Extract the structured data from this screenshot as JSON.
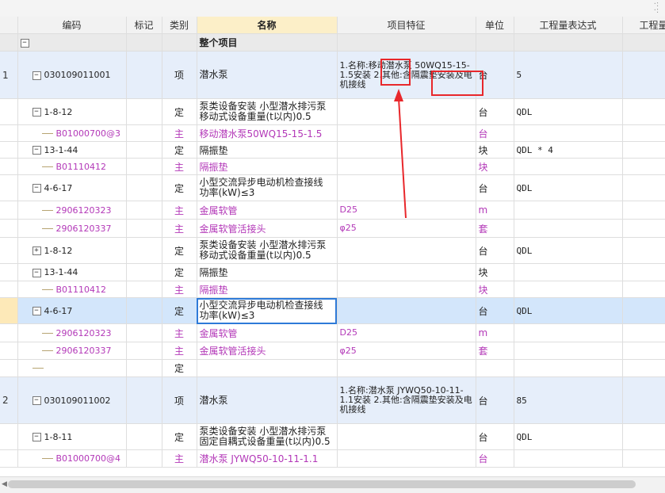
{
  "header": {
    "idx": "",
    "code": "编码",
    "mark": "标记",
    "type": "类别",
    "name": "名称",
    "feature": "项目特征",
    "unit": "单位",
    "qty_expr": "工程量表达式",
    "qty": "工程量"
  },
  "group": {
    "toggle": "−",
    "name": "整个项目"
  },
  "rows": [
    {
      "idx": "1",
      "code": "030109011001",
      "type": "项",
      "name": "潜水泵",
      "feature": "1.名称:移动潜水泵 50WQ15-15-1.5安装 2.其他:含隔震垫安装及电机接线",
      "unit": "台",
      "qty_expr": "5",
      "toggle": "−"
    },
    {
      "idx": "",
      "code": "1-8-12",
      "type": "定",
      "name": "泵类设备安装 小型潜水排污泵 移动式设备重量(t以内)0.5",
      "feature": "",
      "unit": "台",
      "qty_expr": "QDL",
      "toggle": "−"
    },
    {
      "idx": "",
      "code": "B01000700@3",
      "type": "主",
      "name": "移动潜水泵50WQ15-15-1.5",
      "feature": "",
      "unit": "台",
      "qty_expr": ""
    },
    {
      "idx": "",
      "code": "13-1-44",
      "type": "定",
      "name": "隔振垫",
      "feature": "",
      "unit": "块",
      "qty_expr": "QDL * 4",
      "toggle": "−"
    },
    {
      "idx": "",
      "code": "B01110412",
      "type": "主",
      "name": "隔振垫",
      "feature": "",
      "unit": "块",
      "qty_expr": ""
    },
    {
      "idx": "",
      "code": "4-6-17",
      "type": "定",
      "name": "小型交流异步电动机检查接线 功率(kW)≤3",
      "feature": "",
      "unit": "台",
      "qty_expr": "QDL",
      "toggle": "−"
    },
    {
      "idx": "",
      "code": "2906120323",
      "type": "主",
      "name": "金属软管",
      "feature": "D25",
      "unit": "m",
      "qty_expr": ""
    },
    {
      "idx": "",
      "code": "2906120337",
      "type": "主",
      "name": "金属软管活接头",
      "feature": "φ25",
      "unit": "套",
      "qty_expr": ""
    },
    {
      "idx": "",
      "code": "1-8-12",
      "type": "定",
      "name": "泵类设备安装 小型潜水排污泵 移动式设备重量(t以内)0.5",
      "feature": "",
      "unit": "台",
      "qty_expr": "QDL",
      "toggle": "+"
    },
    {
      "idx": "",
      "code": "13-1-44",
      "type": "定",
      "name": "隔振垫",
      "feature": "",
      "unit": "块",
      "qty_expr": "",
      "toggle": "−"
    },
    {
      "idx": "",
      "code": "B01110412",
      "type": "主",
      "name": "隔振垫",
      "feature": "",
      "unit": "块",
      "qty_expr": ""
    },
    {
      "idx": "",
      "code": "4-6-17",
      "type": "定",
      "name": "小型交流异步电动机检查接线 功率(kW)≤3",
      "feature": "",
      "unit": "台",
      "qty_expr": "QDL",
      "toggle": "−"
    },
    {
      "idx": "",
      "code": "2906120323",
      "type": "主",
      "name": "金属软管",
      "feature": "D25",
      "unit": "m",
      "qty_expr": ""
    },
    {
      "idx": "",
      "code": "2906120337",
      "type": "主",
      "name": "金属软管活接头",
      "feature": "φ25",
      "unit": "套",
      "qty_expr": ""
    },
    {
      "idx": "",
      "code": "",
      "type": "定",
      "name": "",
      "feature": "",
      "unit": "",
      "qty_expr": ""
    },
    {
      "idx": "2",
      "code": "030109011002",
      "type": "项",
      "name": "潜水泵",
      "feature": "1.名称:潜水泵 JYWQ50-10-11-1.1安装 2.其他:含隔震垫安装及电机接线",
      "unit": "台",
      "qty_expr": "85",
      "toggle": "−"
    },
    {
      "idx": "",
      "code": "1-8-11",
      "type": "定",
      "name": "泵类设备安装 小型潜水排污泵 固定自耦式设备重量(t以内)0.5",
      "feature": "",
      "unit": "台",
      "qty_expr": "QDL",
      "toggle": "−"
    },
    {
      "idx": "",
      "code": "B01000700@4",
      "type": "主",
      "name": "潜水泵 JYWQ50-10-11-1.1",
      "feature": "",
      "unit": "台",
      "qty_expr": ""
    }
  ],
  "colors": {
    "highlight_border": "#e8272b",
    "selection": "#2e7ad8",
    "main_material": "#b338b8"
  }
}
